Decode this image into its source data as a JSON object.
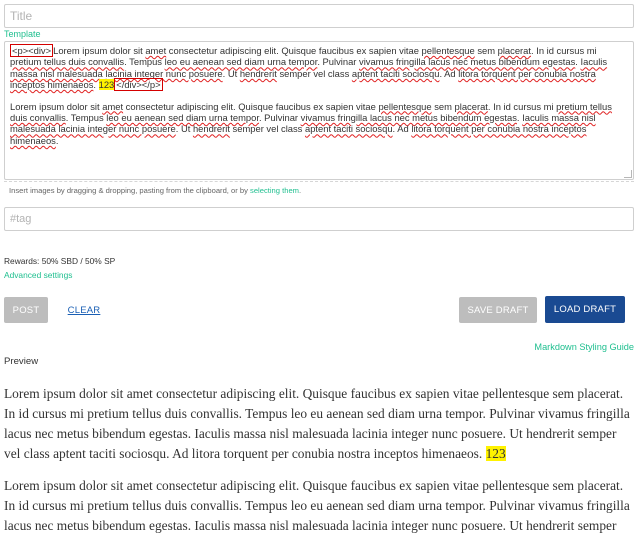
{
  "title_field": {
    "placeholder": "Title",
    "value": ""
  },
  "template_link": "Template",
  "editor": {
    "para1": {
      "open_tag": "<p><div>",
      "before_s1": "Lorem ipsum dolor sit ",
      "s1": "amet",
      "t1": " consectetur adipiscing elit. Quisque faucibus ex sapien vitae ",
      "s2": "pellentesque",
      "t2": " sem ",
      "s3": "placerat",
      "t3": ". In id cursus mi ",
      "s4": "pretium tellus duis convallis",
      "t4": ". Tempus ",
      "s5": "leo eu aenean sed diam urna tempor",
      "t5": ". Pulvinar ",
      "s6": "vivamus fringilla lacus nec metus bibendum egestas",
      "t6": ". ",
      "s7": "Iaculis massa nisl malesuada lacinia integer nunc posuere",
      "t7": ". Ut ",
      "s8": "hendrerit",
      "t8": " semper vel class ",
      "s9": "aptent taciti sociosqu",
      "t9": ". Ad ",
      "s10": "litora torquent per conubia nostra inceptos himenaeos",
      "t10": ". ",
      "number": "123",
      "close_tag": "</div></p>"
    },
    "para2": {
      "before_s1": "Lorem ipsum dolor sit ",
      "s1": "amet",
      "t1": " consectetur adipiscing elit. Quisque faucibus ex sapien vitae ",
      "s2": "pellentesque",
      "t2": " sem ",
      "s3": "placerat",
      "t3": ". In id cursus mi ",
      "s4": "pretium tellus duis convallis",
      "t4": ". Tempus ",
      "s5": "leo eu aenean sed diam urna tempor",
      "t5": ". Pulvinar ",
      "s6": "vivamus fringilla lacus nec metus bibendum egestas",
      "t6": ". ",
      "s7": "Iaculis massa nisl malesuada lacinia integer nunc posuere",
      "t7": ". Ut ",
      "s8": "hendrerit",
      "t8": " semper vel class ",
      "s9": "aptent taciti sociosqu",
      "t9": ". Ad ",
      "s10": "litora torquent per conubia nostra inceptos himenaeos",
      "t10": "."
    }
  },
  "dropzone": {
    "text": "Insert images by dragging & dropping, pasting from the clipboard, or by ",
    "link": "selecting them",
    "end": "."
  },
  "tag_field": {
    "placeholder": "#tag",
    "value": ""
  },
  "rewards": "Rewards: 50% SBD / 50% SP",
  "advanced_settings": "Advanced settings",
  "buttons": {
    "post": "Post",
    "clear": "Clear",
    "save_draft": "Save Draft",
    "load_draft": "Load Draft"
  },
  "markdown_guide": "Markdown Styling Guide",
  "preview": {
    "label": "Preview",
    "para1": "Lorem ipsum dolor sit amet consectetur adipiscing elit. Quisque faucibus ex sapien vitae pellentesque sem placerat. In id cursus mi pretium tellus duis convallis. Tempus leo eu aenean sed diam urna tempor. Pulvinar vivamus fringilla lacus nec metus bibendum egestas. Iaculis massa nisl malesuada lacinia integer nunc posuere. Ut hendrerit semper vel class aptent taciti sociosqu. Ad litora torquent per conubia nostra inceptos himenaeos. ",
    "number": "123",
    "para2": "Lorem ipsum dolor sit amet consectetur adipiscing elit. Quisque faucibus ex sapien vitae pellentesque sem placerat. In id cursus mi pretium tellus duis convallis. Tempus leo eu aenean sed diam urna tempor. Pulvinar vivamus fringilla lacus nec metus bibendum egestas. Iaculis massa nisl malesuada lacinia integer nunc posuere. Ut hendrerit semper vel class aptent taciti sociosqu. Ad litora torquent per conubia nostra inceptos himenaeos."
  },
  "colors": {
    "accent_green": "#1fbf8f",
    "primary_blue": "#1a4a92",
    "disabled_gray": "#bdbdbd",
    "highlight_yellow": "#fff200",
    "tag_outline_red": "#d40000"
  }
}
